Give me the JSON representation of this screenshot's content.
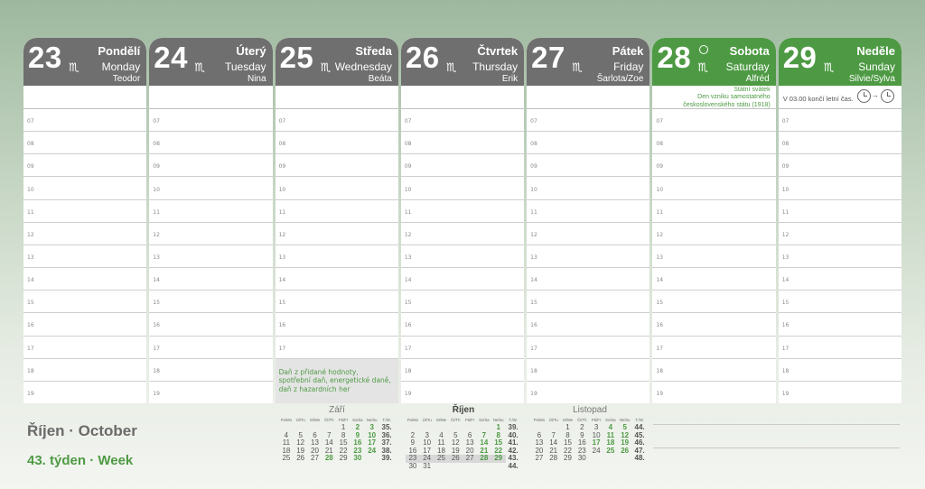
{
  "days": [
    {
      "num": "23",
      "cz": "Pondělí",
      "en": "Monday",
      "nameday": "Teodor",
      "weekend": false
    },
    {
      "num": "24",
      "cz": "Úterý",
      "en": "Tuesday",
      "nameday": "Nina",
      "weekend": false
    },
    {
      "num": "25",
      "cz": "Středa",
      "en": "Wednesday",
      "nameday": "Beáta",
      "weekend": false
    },
    {
      "num": "26",
      "cz": "Čtvrtek",
      "en": "Thursday",
      "nameday": "Erik",
      "weekend": false
    },
    {
      "num": "27",
      "cz": "Pátek",
      "en": "Friday",
      "nameday": "Šarlota/Zoe",
      "weekend": false
    },
    {
      "num": "28",
      "cz": "Sobota",
      "en": "Saturday",
      "nameday": "Alfréd",
      "weekend": true
    },
    {
      "num": "29",
      "cz": "Neděle",
      "en": "Sunday",
      "nameday": "Silvie/Sylva",
      "weekend": true
    }
  ],
  "zodiac_icon": "scorpio-icon",
  "hours": [
    "07",
    "08",
    "09",
    "10",
    "11",
    "12",
    "13",
    "14",
    "15",
    "16",
    "17",
    "18",
    "19"
  ],
  "holiday": {
    "line1": "Státní svátek",
    "line2": "Den vzniku samostatného",
    "line3": "československého státu (1918)"
  },
  "dst_note": "V 03.00 končí letní čas.",
  "dst_arrow": "→",
  "tax_note": {
    "line1": "Daň z přidané hodnoty,",
    "line2": "spotřební daň, energetické daně,",
    "line3": "daň z hazardních her"
  },
  "month_title": "Říjen · October",
  "week_title": "43. týden · Week",
  "mini_calendars": [
    {
      "title": "Září",
      "weekday_heads": [
        "Po/Mo",
        "Út/Tu",
        "St/We",
        "Čt/Th",
        "Pá/Fr",
        "So/Sa",
        "Ne/Su",
        "T./W."
      ],
      "rows": [
        [
          "",
          "",
          "",
          "",
          "1",
          "2",
          "3",
          "35."
        ],
        [
          "4",
          "5",
          "6",
          "7",
          "8",
          "9",
          "10",
          "36."
        ],
        [
          "11",
          "12",
          "13",
          "14",
          "15",
          "16",
          "17",
          "37."
        ],
        [
          "18",
          "19",
          "20",
          "21",
          "22",
          "23",
          "24",
          "38."
        ],
        [
          "25",
          "26",
          "27",
          "28",
          "29",
          "30",
          "",
          "39."
        ]
      ]
    },
    {
      "title": "Říjen",
      "weekday_heads": [
        "Po/Mo",
        "Út/Tu",
        "St/We",
        "Čt/Th",
        "Pá/Fr",
        "So/Sa",
        "Ne/Su",
        "T./W."
      ],
      "rows": [
        [
          "",
          "",
          "",
          "",
          "",
          "",
          "1",
          "39."
        ],
        [
          "2",
          "3",
          "4",
          "5",
          "6",
          "7",
          "8",
          "40."
        ],
        [
          "9",
          "10",
          "11",
          "12",
          "13",
          "14",
          "15",
          "41."
        ],
        [
          "16",
          "17",
          "18",
          "19",
          "20",
          "21",
          "22",
          "42."
        ],
        [
          "23",
          "24",
          "25",
          "26",
          "27",
          "28",
          "29",
          "43."
        ],
        [
          "30",
          "31",
          "",
          "",
          "",
          "",
          "",
          "44."
        ]
      ]
    },
    {
      "title": "Listopad",
      "weekday_heads": [
        "Po/Mo",
        "Út/Tu",
        "St/We",
        "Čt/Th",
        "Pá/Fr",
        "So/Sa",
        "Ne/Su",
        "T./W."
      ],
      "rows": [
        [
          "",
          "",
          "1",
          "2",
          "3",
          "4",
          "5",
          "44."
        ],
        [
          "6",
          "7",
          "8",
          "9",
          "10",
          "11",
          "12",
          "45."
        ],
        [
          "13",
          "14",
          "15",
          "16",
          "17",
          "18",
          "19",
          "46."
        ],
        [
          "20",
          "21",
          "22",
          "23",
          "24",
          "25",
          "26",
          "47."
        ],
        [
          "27",
          "28",
          "29",
          "30",
          "",
          "",
          "",
          "48."
        ]
      ]
    }
  ],
  "colors": {
    "weekday_header": "#6f6f6f",
    "weekend_header": "#4e9a44",
    "accent_green": "#4e9a44"
  }
}
